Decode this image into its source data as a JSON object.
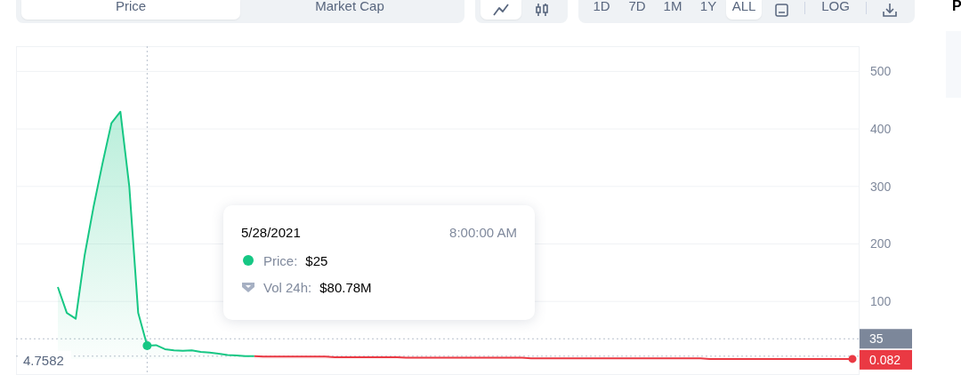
{
  "toolbar": {
    "view_tabs": [
      {
        "label": "Price",
        "selected": true
      },
      {
        "label": "Market Cap",
        "selected": false
      }
    ],
    "chart_types": [
      {
        "kind": "line",
        "selected": true
      },
      {
        "kind": "candles",
        "selected": false
      }
    ],
    "ranges": [
      {
        "label": "1D",
        "selected": false
      },
      {
        "label": "7D",
        "selected": false
      },
      {
        "label": "1M",
        "selected": false
      },
      {
        "label": "1Y",
        "selected": false
      },
      {
        "label": "ALL",
        "selected": true
      }
    ],
    "log_button": "LOG"
  },
  "side_heading": "P",
  "chart": {
    "last_price_label": "0.082",
    "chart_data": {
      "type": "area",
      "ylim": [
        -28,
        547
      ],
      "yticks": [
        100,
        200,
        300,
        400,
        500
      ],
      "grid": true,
      "ref_lines": [
        {
          "label": "4.7582"
        },
        {
          "label": "35"
        }
      ],
      "categories": [
        null,
        null,
        null,
        null,
        null,
        null,
        null,
        null,
        null,
        null,
        null,
        null,
        null,
        null,
        null,
        null,
        null,
        null,
        null,
        null,
        null,
        null,
        null,
        null,
        null,
        null,
        null,
        null,
        null,
        null,
        null,
        null,
        null,
        null,
        null,
        null,
        null,
        null,
        null,
        null,
        null,
        null,
        null,
        null,
        null,
        null,
        null,
        null,
        null,
        null,
        null,
        null,
        null,
        null,
        null,
        null,
        null,
        null,
        null,
        null,
        null,
        null,
        null,
        null,
        null,
        null,
        null,
        null,
        null,
        null,
        null,
        null,
        null,
        null,
        null,
        null,
        null,
        null,
        null,
        null,
        null,
        null,
        null,
        null,
        null,
        null,
        null,
        null,
        null,
        null,
        null
      ],
      "series": [
        {
          "color": "#16c784",
          "values": [
            null,
            125,
            80,
            70,
            180,
            265,
            340,
            410,
            430,
            300,
            80,
            23,
            24,
            17,
            15,
            14,
            15,
            12,
            11,
            9,
            7,
            6,
            5,
            5,
            null,
            null,
            null,
            null,
            null,
            null,
            null,
            null,
            null,
            null,
            null,
            null,
            null,
            null,
            null,
            null,
            null,
            null,
            null,
            null,
            null,
            null,
            null,
            null,
            null,
            null,
            null,
            null,
            null,
            null,
            null,
            null,
            null,
            null,
            null,
            null,
            null,
            null,
            null,
            null,
            null,
            null,
            null,
            null,
            null,
            null,
            null,
            null,
            null,
            null,
            null,
            null,
            null,
            null,
            null,
            null,
            null,
            null,
            null,
            null,
            null,
            null,
            null,
            null,
            null,
            null,
            null
          ]
        },
        {
          "color": "#ea3943",
          "values": [
            null,
            null,
            null,
            null,
            null,
            null,
            null,
            null,
            null,
            null,
            null,
            null,
            null,
            null,
            null,
            null,
            null,
            null,
            null,
            null,
            null,
            null,
            null,
            5,
            4,
            4,
            4,
            4,
            4,
            4,
            4,
            4,
            3,
            3,
            3,
            3,
            3,
            3,
            3,
            3,
            2,
            2,
            2,
            2,
            2,
            2,
            2,
            2,
            2,
            2,
            2,
            2,
            2,
            2,
            1,
            1,
            1,
            1,
            1,
            1,
            1,
            1,
            1,
            1,
            1,
            1,
            1,
            1,
            1,
            1,
            1,
            1,
            1,
            1,
            0,
            0,
            0,
            0,
            0,
            0,
            0,
            0,
            0,
            0,
            0,
            0,
            0,
            0,
            0,
            0,
            0
          ]
        }
      ]
    },
    "tooltip": {
      "date": "5/28/2021",
      "time": "8:00:00 AM",
      "price_label": "Price:",
      "price": "$25",
      "volume_label": "Vol 24h:",
      "volume": "$80.78M"
    }
  }
}
